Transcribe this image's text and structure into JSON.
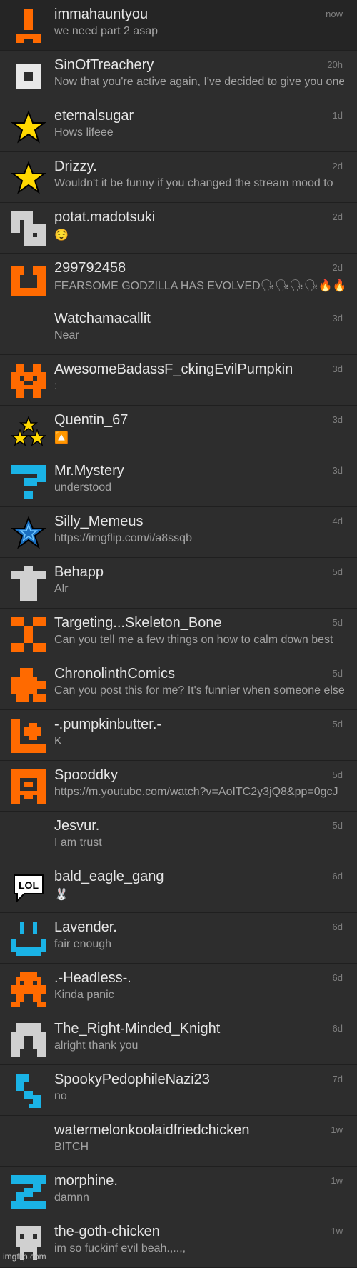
{
  "colors": {
    "background": "#2d2d2d",
    "name_text": "#e6e6e6",
    "message_text": "#a3a3a3",
    "time_text": "#7e7e7e",
    "orange": "#ff6a00",
    "cyan": "#1ab3e6",
    "gray": "#d0d0d0",
    "yellow": "#ffd800"
  },
  "conversations": [
    {
      "name": "immahauntyou",
      "message": "we need part 2 asap",
      "time": "now",
      "icon": "orange-exclamation-icon",
      "color": "#ff6a00"
    },
    {
      "name": "SinOfTreachery",
      "message": "Now that you're active again, I've decided to give you one",
      "time": "20h",
      "icon": "white-square-icon",
      "color": "#e8e8e8"
    },
    {
      "name": "eternalsugar",
      "message": "Hows lifeee",
      "time": "1d",
      "icon": "yellow-star-icon",
      "color": "#ffd800"
    },
    {
      "name": "Drizzy.",
      "message": "Wouldn't it be funny if you changed the stream mood to",
      "time": "2d",
      "icon": "yellow-star-icon",
      "color": "#ffd800"
    },
    {
      "name": "potat.madotsuki",
      "message": "😌",
      "time": "2d",
      "icon": "gray-pixel-icon",
      "color": "#d0d0d0"
    },
    {
      "name": "299792458",
      "message": "FEARSOME GODZILLA HAS EVOLVED🗣🗣🗣🗣🔥🔥🔥",
      "time": "2d",
      "icon": "orange-smile-icon",
      "color": "#ff6a00"
    },
    {
      "name": "Watchamacallit",
      "message": "Near",
      "time": "3d",
      "icon": "",
      "color": ""
    },
    {
      "name": "AwesomeBadassF_ckingEvilPumpkin",
      "message": ":",
      "time": "3d",
      "icon": "orange-pumpkin-icon",
      "color": "#ff6a00"
    },
    {
      "name": "Quentin_67",
      "message": "🔼",
      "time": "3d",
      "icon": "three-stars-icon",
      "color": "#ffd800"
    },
    {
      "name": "Mr.Mystery",
      "message": "understood",
      "time": "3d",
      "icon": "cyan-question-icon",
      "color": "#1ab3e6"
    },
    {
      "name": "Silly_Memeus",
      "message": "https://imgflip.com/i/a8ssqb",
      "time": "4d",
      "icon": "blue-star-icon",
      "color": "#1a8ae6"
    },
    {
      "name": "Behapp",
      "message": "Alr",
      "time": "5d",
      "icon": "gray-shirt-icon",
      "color": "#d0d0d0"
    },
    {
      "name": "Targeting...Skeleton_Bone",
      "message": "Can you tell me a few things on how to calm down best",
      "time": "5d",
      "icon": "orange-bone-icon",
      "color": "#ff6a00"
    },
    {
      "name": "ChronolinthComics",
      "message": "Can you post this for me? It's funnier when someone else",
      "time": "5d",
      "icon": "orange-puzzle-icon",
      "color": "#ff6a00"
    },
    {
      "name": "-.pumpkinbutter.-",
      "message": "K",
      "time": "5d",
      "icon": "orange-plus-icon",
      "color": "#ff6a00"
    },
    {
      "name": "Spooddky",
      "message": "https://m.youtube.com/watch?v=AoITC2y3jQ8&pp=0gcJ",
      "time": "5d",
      "icon": "orange-ghost-icon",
      "color": "#ff6a00"
    },
    {
      "name": "Jesvur.",
      "message": "I am trust",
      "time": "5d",
      "icon": "",
      "color": ""
    },
    {
      "name": "bald_eagle_gang",
      "message": "🐰",
      "time": "6d",
      "icon": "lol-bubble-icon",
      "color": "#ffffff"
    },
    {
      "name": "Lavender.",
      "message": "fair enough",
      "time": "6d",
      "icon": "cyan-smile-icon",
      "color": "#1ab3e6"
    },
    {
      "name": ".-Headless-.",
      "message": "Kinda panic",
      "time": "6d",
      "icon": "orange-invader-icon",
      "color": "#ff6a00"
    },
    {
      "name": "The_Right-Minded_Knight",
      "message": "alright thank you",
      "time": "6d",
      "icon": "gray-helmet-icon",
      "color": "#d0d0d0"
    },
    {
      "name": "SpookyPedophileNazi23",
      "message": "no",
      "time": "7d",
      "icon": "cyan-zigzag-icon",
      "color": "#1ab3e6"
    },
    {
      "name": "watermelonkoolaidfriedchicken",
      "message": "BITCH",
      "time": "1w",
      "icon": "",
      "color": ""
    },
    {
      "name": "morphine.",
      "message": "damnn",
      "time": "1w",
      "icon": "cyan-swirl-icon",
      "color": "#1ab3e6"
    },
    {
      "name": "the-goth-chicken",
      "message": "im so fuckinf evil beah.,..,,",
      "time": "1w",
      "icon": "gray-skull-icon",
      "color": "#d0d0d0"
    }
  ],
  "watermark": "imgflip.com"
}
